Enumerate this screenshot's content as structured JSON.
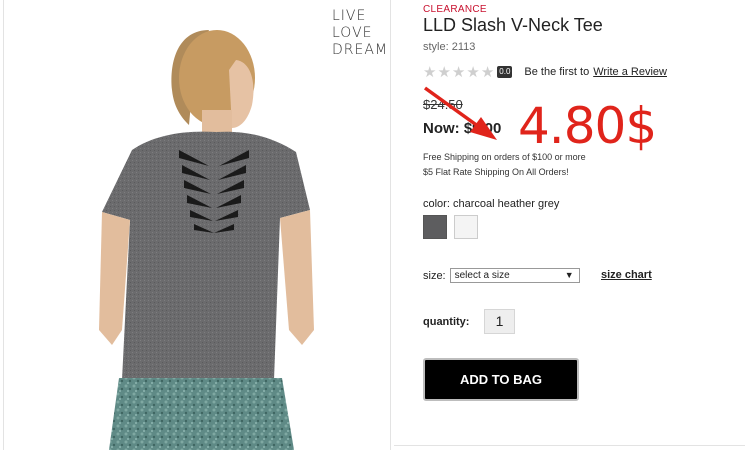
{
  "product": {
    "tag": "CLEARANCE",
    "title": "LLD Slash V-Neck Tee",
    "style": "style: 2113",
    "rating_value": "0.0",
    "stars_filled": 0,
    "stars_total": 5,
    "review_prompt": "Be the first to",
    "review_link": "Write a Review",
    "old_price": "$24.50",
    "now_price": "Now: $9.00",
    "shipping_lines": [
      "Free Shipping on orders of $100 or more",
      "$5 Flat Rate Shipping On All Orders!"
    ],
    "color_label": "color: charcoal heather grey",
    "swatches": [
      {
        "name": "charcoal heather grey",
        "color": "#5d5d5f",
        "selected": true
      },
      {
        "name": "white",
        "color": "#f4f4f4",
        "selected": false
      }
    ],
    "size_label": "size:",
    "size_select_value": "select a size",
    "size_chart_label": "size chart",
    "quantity_label": "quantity:",
    "quantity_value": "1",
    "add_to_bag_label": "ADD TO BAG"
  },
  "brand_logo": [
    "LIVE",
    "LOVE",
    "DREAM"
  ],
  "overlay": {
    "price_text": "4.80$",
    "color": "#e0241b"
  },
  "colors": {
    "accent_red": "#c8102e",
    "button_bg": "#000000",
    "shirt_grey": "#6b6b6d",
    "pants_teal": "#5f8a86"
  }
}
